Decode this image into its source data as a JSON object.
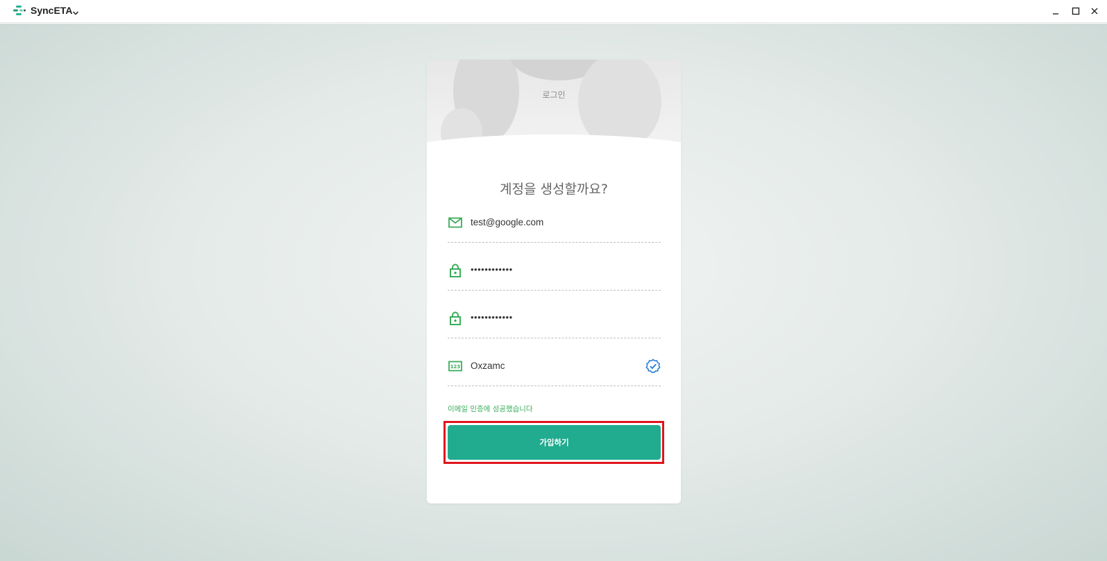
{
  "window": {
    "app_name": "SyncETA",
    "logo_icon": "synceta-logo-icon",
    "menu_icon": "chevron-down-icon",
    "controls": [
      "minimize-icon",
      "maximize-icon",
      "close-icon"
    ]
  },
  "card": {
    "header_link": "로그인",
    "heading": "계정을 생성할까요?",
    "fields": {
      "email": {
        "icon": "mail-icon",
        "value": "test@google.com"
      },
      "password": {
        "icon": "lock-icon",
        "value": "••••••••••••"
      },
      "password_confirm": {
        "icon": "lock-icon",
        "value": "••••••••••••"
      },
      "verification_code": {
        "icon": "number-123-icon",
        "value": "Oxzamc",
        "status_icon": "verified-check-icon"
      }
    },
    "success_message": "이메일 인증에 성공했습니다",
    "submit_label": "가입하기"
  },
  "colors": {
    "accent": "#21ab8f",
    "icon_green": "#3aad5a",
    "success_text": "#3aad5a",
    "verified_blue": "#2b7fd9",
    "highlight": "#e0141e"
  }
}
